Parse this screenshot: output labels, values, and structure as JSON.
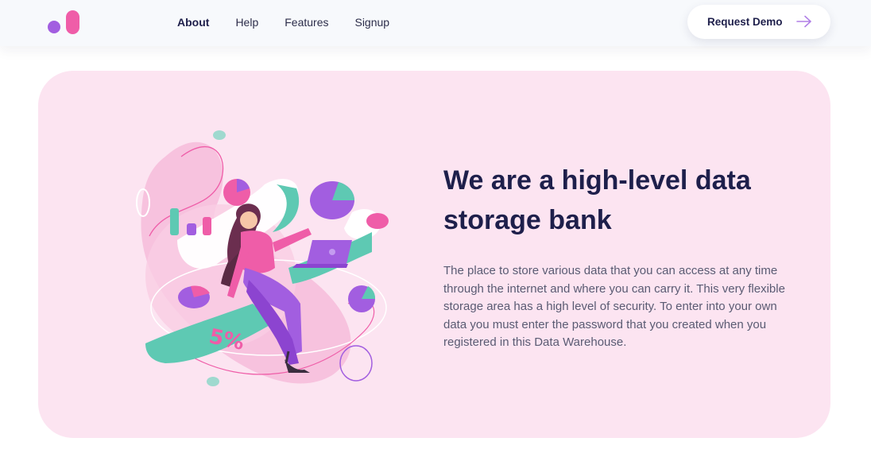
{
  "nav": {
    "links": [
      "About",
      "Help",
      "Features",
      "Signup"
    ],
    "active": "About",
    "cta_label": "Request Demo"
  },
  "hero": {
    "title": "We are a high-level data storage bank",
    "description": "The place to store various data that you can access at any time through the internet and where you can carry it. This very flexible storage area has a high level of security. To enter into your own data you must enter the password that you created when you registered in this Data Warehouse.",
    "illustration_text": "5%"
  },
  "colors": {
    "brand_dark": "#1e1f4b",
    "purple": "#a25ee0",
    "pink": "#ef5da8",
    "teal": "#5ec9b3",
    "hero_bg": "#fce4f1"
  }
}
